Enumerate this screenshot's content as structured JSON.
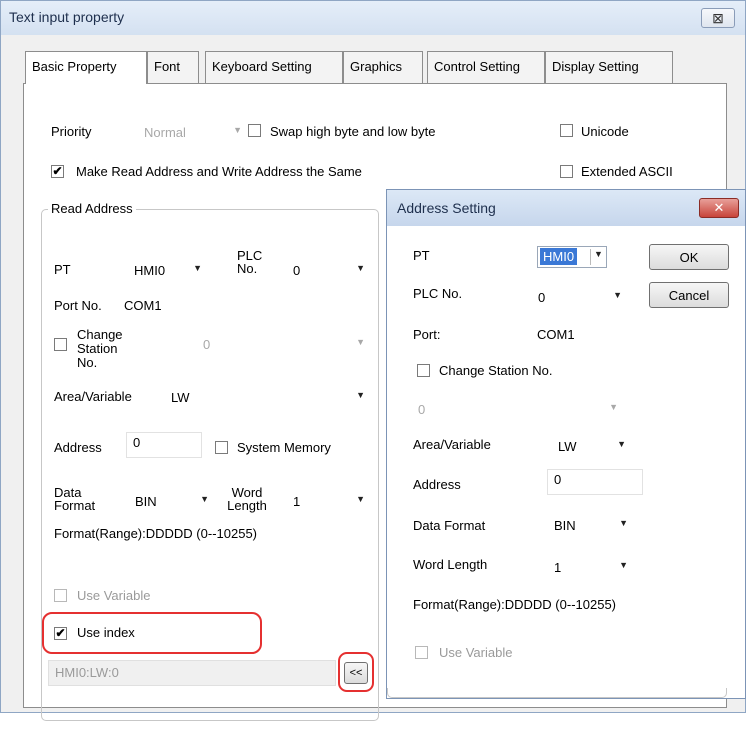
{
  "main_dialog": {
    "title": "Text input property",
    "close_glyph": "⊠",
    "tabs": [
      {
        "label": "Basic Property",
        "active": true
      },
      {
        "label": "Font",
        "active": false
      },
      {
        "label": "Keyboard Setting",
        "active": false
      },
      {
        "label": "Graphics",
        "active": false
      },
      {
        "label": "Control Setting",
        "active": false
      },
      {
        "label": "Display Setting",
        "active": false
      }
    ],
    "priority": {
      "label": "Priority",
      "value": "Normal"
    },
    "swap_bytes": {
      "label": "Swap high byte and low byte",
      "checked": false
    },
    "unicode": {
      "label": "Unicode",
      "checked": false
    },
    "same_address": {
      "label": "Make Read Address and Write Address the Same",
      "checked": true
    },
    "extended_ascii": {
      "label": "Extended ASCII",
      "checked": false
    },
    "read_address": {
      "group_title": "Read Address",
      "pt_label": "PT",
      "pt_value": "HMI0",
      "plc_no_label": "PLC No.",
      "plc_no_value": "0",
      "port_label": "Port No.",
      "port_value": "COM1",
      "change_station_label": "Change Station No.",
      "change_station_checked": false,
      "station_value": "0",
      "area_label": "Area/Variable",
      "area_value": "LW",
      "address_label": "Address",
      "address_value": "0",
      "system_memory_label": "System Memory",
      "system_memory_checked": false,
      "data_format_label": "Data Format",
      "data_format_value": "BIN",
      "word_length_label": "Word Length",
      "word_length_value": "1",
      "format_range": "Format(Range):DDDDD (0--10255)",
      "use_variable_label": "Use Variable",
      "use_variable_checked": false,
      "use_index_label": "Use index",
      "use_index_checked": true,
      "address_display": "HMI0:LW:0",
      "expand_button": "<<"
    }
  },
  "address_dialog": {
    "title": "Address Setting",
    "close_glyph": "✕",
    "pt_label": "PT",
    "pt_value": "HMI0",
    "ok_label": "OK",
    "cancel_label": "Cancel",
    "plc_no_label": "PLC No.",
    "plc_no_value": "0",
    "port_label": "Port:",
    "port_value": "COM1",
    "change_station_label": "Change Station No.",
    "change_station_checked": false,
    "station_value": "0",
    "area_label": "Area/Variable",
    "area_value": "LW",
    "address_label": "Address",
    "address_value": "0",
    "data_format_label": "Data  Format",
    "data_format_value": "BIN",
    "word_length_label": "Word Length",
    "word_length_value": "1",
    "format_range": "Format(Range):DDDDD (0--10255)",
    "use_variable_label": "Use Variable",
    "use_variable_checked": false
  },
  "colors": {
    "highlight_red": "#e53030",
    "selection_blue": "#3a78d6",
    "titlebar": "#d4e1f1"
  },
  "icons": {
    "dropdown": "chevron-down-icon",
    "checkmark": "check-icon",
    "close": "close-icon"
  }
}
